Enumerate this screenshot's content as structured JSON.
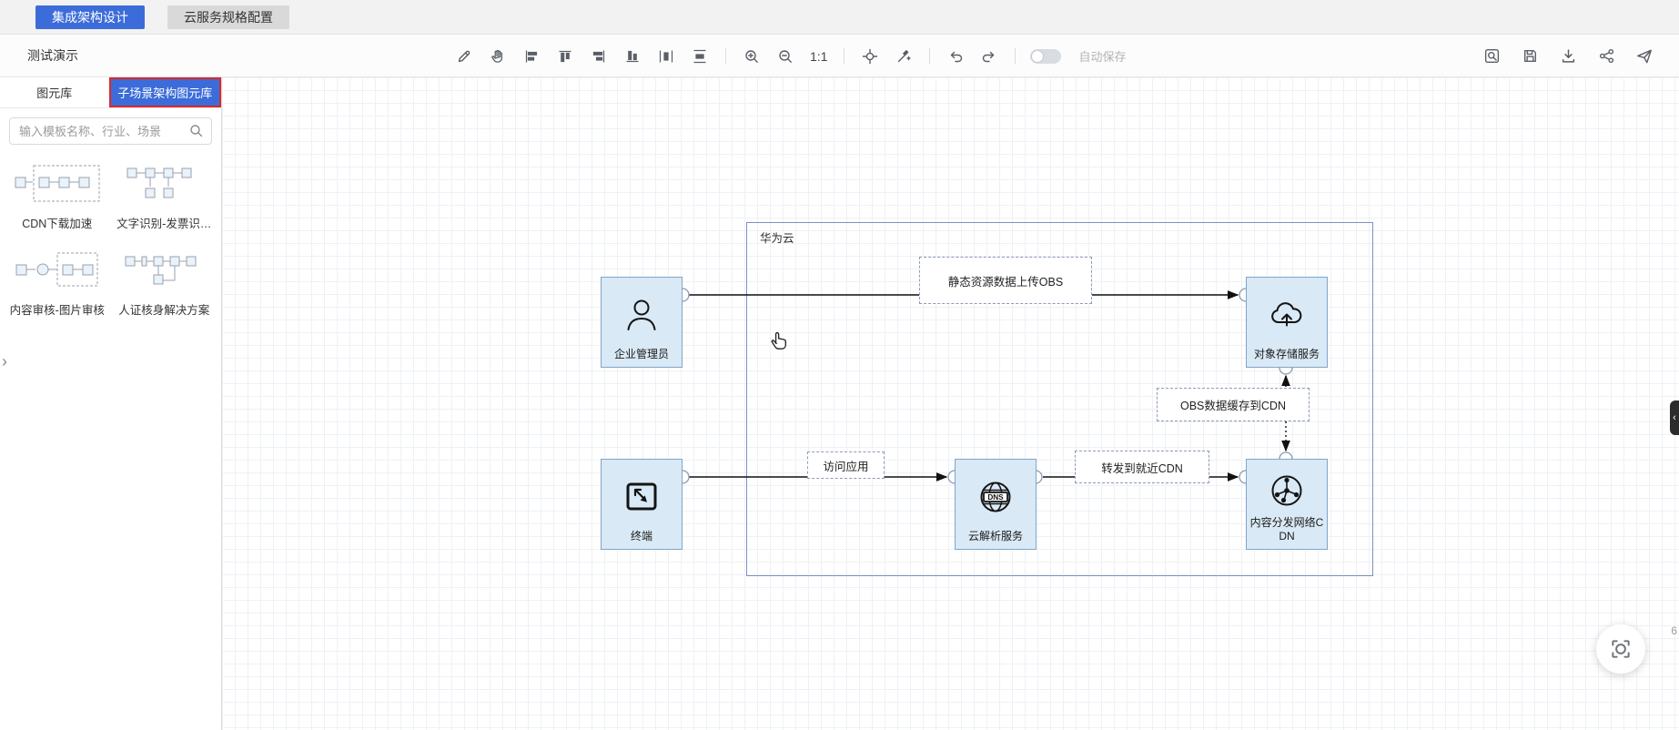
{
  "top_tabs": [
    {
      "label": "集成架构设计",
      "active": true
    },
    {
      "label": "云服务规格配置",
      "active": false
    }
  ],
  "toolbar": {
    "project_name": "测试演示",
    "zoom_ratio_label": "1:1",
    "autosave_label": "自动保存",
    "autosave_enabled": false,
    "center_icons": [
      "edit-pen",
      "pan-hand",
      "align-left",
      "align-top",
      "align-right",
      "align-bottom",
      "distribute-horizontal",
      "distribute-vertical",
      "zoom-in",
      "zoom-out",
      "center-focus",
      "format-painter",
      "undo",
      "redo"
    ],
    "right_icons": [
      "preview",
      "save",
      "download",
      "share",
      "publish"
    ]
  },
  "sidebar": {
    "tabs": [
      {
        "label": "图元库",
        "active": false
      },
      {
        "label": "子场景架构图元库",
        "active": true
      }
    ],
    "search_placeholder": "输入模板名称、行业、场景",
    "templates": [
      {
        "label": "CDN下载加速"
      },
      {
        "label": "文字识别-发票识…"
      },
      {
        "label": "内容审核-图片审核"
      },
      {
        "label": "人证核身解决方案"
      }
    ]
  },
  "canvas": {
    "group_label": "华为云",
    "nodes": {
      "admin": {
        "label": "企业管理员"
      },
      "obs": {
        "label": "对象存储服务"
      },
      "terminal": {
        "label": "终端"
      },
      "dns": {
        "label": "云解析服务",
        "icon_text": "DNS"
      },
      "cdn": {
        "label": "内容分发网络CDN"
      }
    },
    "edge_labels": {
      "upload": "静态资源数据上传OBS",
      "visit": "访问应用",
      "forward": "转发到就近CDN",
      "cache": "OBS数据缓存到CDN"
    }
  },
  "misc": {
    "edge_partial_text": "6"
  },
  "colors": {
    "accent_blue": "#3c6cd9",
    "tab_highlight_border": "#e02626",
    "node_fill": "#d9e9f5",
    "node_border": "#7fa6c9",
    "group_border": "#8091c0"
  }
}
